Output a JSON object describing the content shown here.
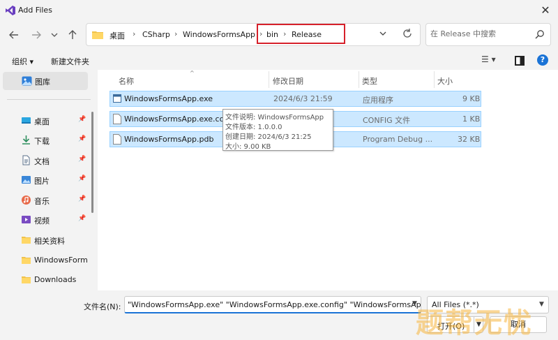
{
  "window": {
    "title": "Add Files",
    "close_label": "✕"
  },
  "address": {
    "crumbs": [
      "桌面",
      "CSharp",
      "WindowsFormsApp",
      "bin",
      "Release"
    ],
    "separator": "›"
  },
  "search": {
    "placeholder": "在 Release 中搜索"
  },
  "toolbar": {
    "organize": "组织 ▾",
    "new_folder": "新建文件夹",
    "view": "☰ ▾",
    "help": "?"
  },
  "sidebar": {
    "gallery": "图库",
    "items": [
      {
        "label": "桌面",
        "icon": "desktop-icon",
        "pinned": true
      },
      {
        "label": "下载",
        "icon": "download-icon",
        "pinned": true
      },
      {
        "label": "文档",
        "icon": "documents-icon",
        "pinned": true
      },
      {
        "label": "图片",
        "icon": "pictures-icon",
        "pinned": true
      },
      {
        "label": "音乐",
        "icon": "music-icon",
        "pinned": true
      },
      {
        "label": "视频",
        "icon": "videos-icon",
        "pinned": true
      },
      {
        "label": "相关资料",
        "icon": "folder-icon",
        "pinned": false
      },
      {
        "label": "WindowsForm",
        "icon": "folder-icon",
        "pinned": false
      },
      {
        "label": "Downloads",
        "icon": "folder-icon",
        "pinned": false
      }
    ]
  },
  "columns": {
    "name": "名称",
    "modified": "修改日期",
    "type": "类型",
    "size": "大小"
  },
  "files": [
    {
      "name": "WindowsFormsApp.exe",
      "modified": "2024/6/3 21:59",
      "type": "应用程序",
      "size": "9 KB"
    },
    {
      "name": "WindowsFormsApp.exe.config",
      "modified": "",
      "type": "CONFIG 文件",
      "size": "1 KB"
    },
    {
      "name": "WindowsFormsApp.pdb",
      "modified": "",
      "type": "Program Debug ...",
      "size": "32 KB"
    }
  ],
  "tooltip": {
    "description": "文件说明: WindowsFormsApp",
    "version": "文件版本: 1.0.0.0",
    "created": "创建日期: 2024/6/3 21:25",
    "size": "大小: 9.00 KB"
  },
  "footer": {
    "filename_label": "文件名(N):",
    "filename_value": "\"WindowsFormsApp.exe\" \"WindowsFormsApp.exe.config\" \"WindowsFormsAp",
    "filter": "All Files (*.*)",
    "open": "打开(O)",
    "cancel": "取消"
  },
  "watermark": "题帮无忧",
  "colors": {
    "selection": "#cce8ff",
    "highlight_border": "#d6202a",
    "accent": "#1a73d6"
  }
}
